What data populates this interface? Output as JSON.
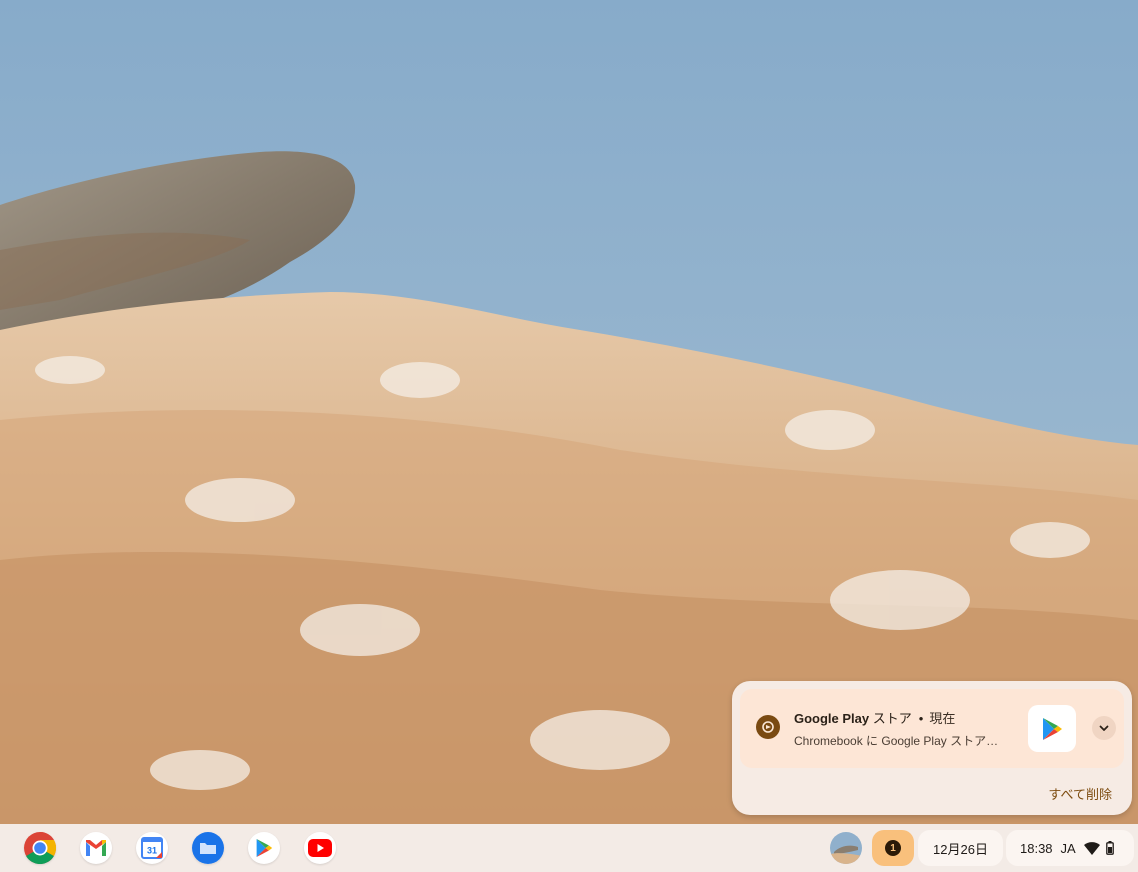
{
  "notification": {
    "app_name": "Google Play",
    "app_suffix": "ストア",
    "separator": "•",
    "time": "現在",
    "body": "Chromebook に Google Play ストア…",
    "clear_all": "すべて削除",
    "icon": "google-play-icon",
    "accent": "#7a4a12"
  },
  "shelf": {
    "apps": [
      {
        "name": "chrome",
        "icon": "chrome-icon"
      },
      {
        "name": "gmail",
        "icon": "gmail-icon"
      },
      {
        "name": "calendar",
        "icon": "calendar-icon",
        "label": "31"
      },
      {
        "name": "files",
        "icon": "files-icon"
      },
      {
        "name": "play-store",
        "icon": "play-store-icon"
      },
      {
        "name": "youtube",
        "icon": "youtube-icon"
      }
    ],
    "tray": {
      "notification_count": "1",
      "date": "12月26日",
      "time": "18:38",
      "ime": "JA",
      "notification_color": "#f9c07c"
    }
  }
}
